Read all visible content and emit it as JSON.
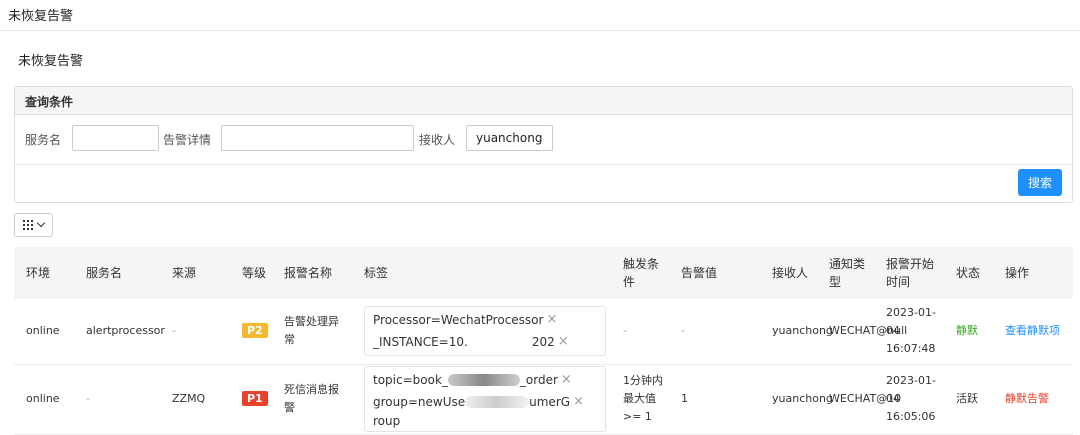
{
  "topbar": {
    "title": "未恢复告警"
  },
  "page": {
    "heading": "未恢复告警"
  },
  "query": {
    "title": "查询条件",
    "service_label": "服务名",
    "service_value": "",
    "detail_label": "告警详情",
    "detail_value": "",
    "receiver_label": "接收人",
    "receiver_value": "yuanchong",
    "search_button": "搜索"
  },
  "table": {
    "headers": [
      "环境",
      "服务名",
      "来源",
      "等级",
      "报警名称",
      "标签",
      "触发条件",
      "告警值",
      "接收人",
      "通知类型",
      "报警开始时间",
      "状态",
      "操作"
    ],
    "rows": [
      {
        "env": "online",
        "service": "alertprocessor",
        "source": "-",
        "level": "P2",
        "name": "告警处理异常",
        "tags": [
          "Processor=WechatProcessor",
          "_INSTANCE=10.",
          "202"
        ],
        "condition": "-",
        "value": "-",
        "receiver": "yuanchong",
        "notify_type": "WECHAT@null",
        "start_time": "2023-01-04 16:07:48",
        "status": "静默",
        "action": "查看静默项"
      },
      {
        "env": "online",
        "service": "-",
        "source": "ZZMQ",
        "level": "P1",
        "name": "死信消息报警",
        "tags": [
          "topic=book_",
          "_order",
          "group=newUse",
          "umerG",
          "roup"
        ],
        "condition": "1分钟内最大值 >= 1",
        "value": "1",
        "receiver": "yuanchong",
        "notify_type": "WECHAT@10",
        "start_time": "2023-01-04 16:05:06",
        "status": "活跃",
        "action": "静默告警"
      }
    ]
  },
  "colors": {
    "accent": "#1e90ff",
    "p1": "#e8412c",
    "p2": "#f5b82e",
    "silent": "#3aa820"
  },
  "icons": {
    "column_toggle": "grid-icon",
    "dropdown": "chevron-down-icon",
    "tag_remove": "close-icon"
  }
}
